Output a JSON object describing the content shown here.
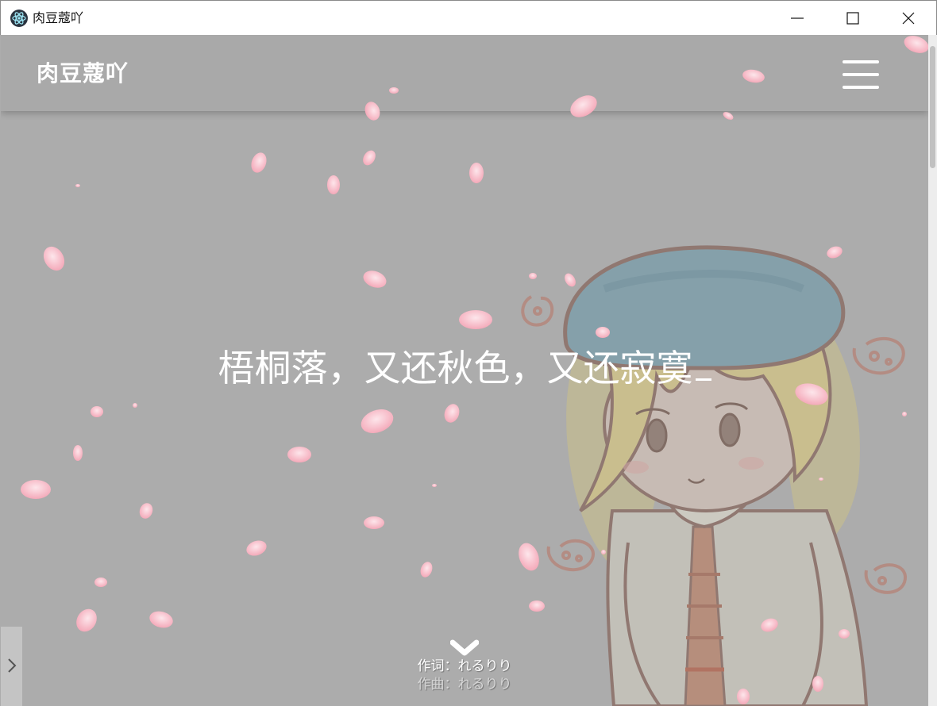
{
  "window": {
    "title": "肉豆蔻吖",
    "app_icon": "electron-atom-icon",
    "controls": [
      "minimize-icon",
      "maximize-icon",
      "close-icon"
    ]
  },
  "navbar": {
    "brand": "肉豆蔻吖",
    "menu_icon": "hamburger-menu-icon"
  },
  "hero": {
    "headline": "梧桐落，又还秋色，又还寂寞",
    "cursor_char": "_",
    "scroll_icon": "chevron-down-icon"
  },
  "music": {
    "lyricist": "作词：れるりり",
    "composer": "作曲：れるりり"
  },
  "side_panel": {
    "toggle_icon": "chevron-right-icon"
  },
  "colors": {
    "overlay": "#acacac",
    "petal": "#f9c8d2",
    "text": "#ffffff"
  }
}
